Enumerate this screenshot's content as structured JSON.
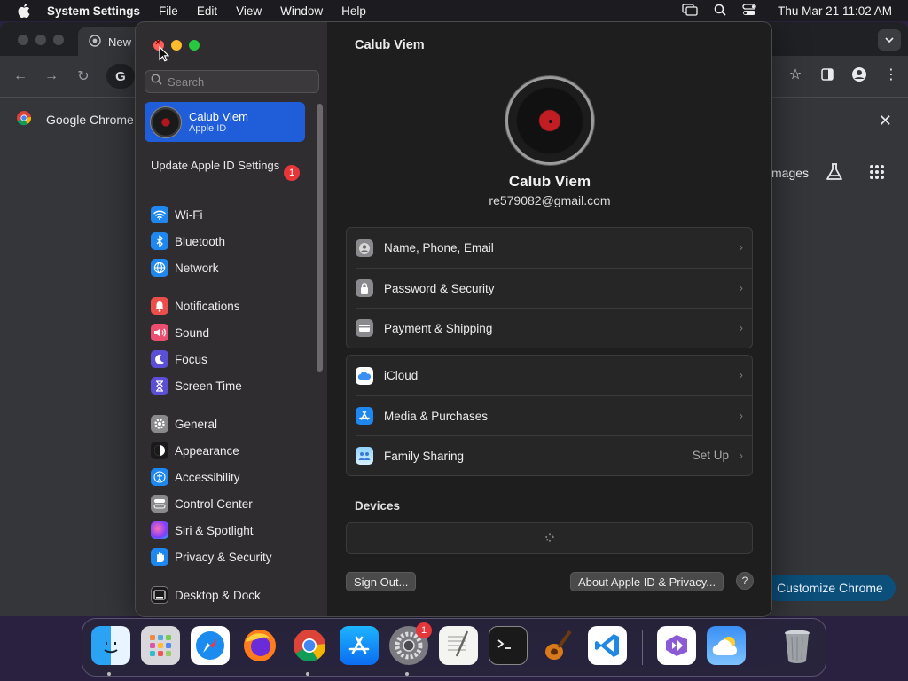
{
  "menubar": {
    "app_name": "System Settings",
    "menus": [
      "File",
      "Edit",
      "View",
      "Window",
      "Help"
    ],
    "clock": "Thu Mar 21  11:02 AM"
  },
  "chrome": {
    "tab_title": "New",
    "omnibox_letter": "G",
    "infobar_text": "Google Chrome i",
    "images_link": "mages",
    "customize_label": "Customize Chrome"
  },
  "settings": {
    "search_placeholder": "Search",
    "apple_id": {
      "name": "Calub Viem",
      "subtitle": "Apple ID"
    },
    "update_notice": "Update Apple ID Settings",
    "update_badge": "1",
    "sidebar_items": [
      {
        "label": "Wi-Fi",
        "icon": "wifi-icon",
        "color": "#1e88f0"
      },
      {
        "label": "Bluetooth",
        "icon": "bluetooth-icon",
        "color": "#1e88f0"
      },
      {
        "label": "Network",
        "icon": "globe-icon",
        "color": "#1e88f0"
      },
      {
        "label": "Notifications",
        "icon": "bell-icon",
        "color": "#eb4e4b"
      },
      {
        "label": "Sound",
        "icon": "speaker-icon",
        "color": "#eb4e6e"
      },
      {
        "label": "Focus",
        "icon": "moon-icon",
        "color": "#5b4fd6"
      },
      {
        "label": "Screen Time",
        "icon": "hourglass-icon",
        "color": "#5b4fd6"
      },
      {
        "label": "General",
        "icon": "gear-icon",
        "color": "#8a8a8e"
      },
      {
        "label": "Appearance",
        "icon": "appearance-icon",
        "color": "#1a1a1a"
      },
      {
        "label": "Accessibility",
        "icon": "accessibility-icon",
        "color": "#1e88f0"
      },
      {
        "label": "Control Center",
        "icon": "control-center-icon",
        "color": "#8a8a8e"
      },
      {
        "label": "Siri & Spotlight",
        "icon": "siri-icon",
        "color": "#b04fd6"
      },
      {
        "label": "Privacy & Security",
        "icon": "hand-icon",
        "color": "#1e88f0"
      },
      {
        "label": "Desktop & Dock",
        "icon": "dock-icon",
        "color": "#1a1a1a"
      }
    ],
    "main": {
      "title": "Calub Viem",
      "user_name": "Calub Viem",
      "user_email": "re579082@gmail.com",
      "group1": [
        {
          "label": "Name, Phone, Email",
          "icon": "contact-icon"
        },
        {
          "label": "Password & Security",
          "icon": "lock-icon"
        },
        {
          "label": "Payment & Shipping",
          "icon": "card-icon"
        }
      ],
      "group2": [
        {
          "label": "iCloud",
          "icon": "icloud-icon",
          "value": ""
        },
        {
          "label": "Media & Purchases",
          "icon": "app-store-icon",
          "value": ""
        },
        {
          "label": "Family Sharing",
          "icon": "family-icon",
          "value": "Set Up"
        }
      ],
      "devices_label": "Devices",
      "sign_out_label": "Sign Out...",
      "about_label": "About Apple ID & Privacy...",
      "help_label": "?"
    }
  },
  "dock": {
    "apps": [
      "Finder",
      "Launchpad",
      "Safari",
      "Firefox",
      "Google Chrome",
      "App Store",
      "System Settings",
      "TextEdit",
      "Terminal",
      "GarageBand",
      "Visual Studio Code",
      "Visual Studio",
      "Weather",
      "Trash"
    ],
    "settings_badge": "1"
  },
  "colors": {
    "accent": "#1f5ed8",
    "badge": "#e6363a",
    "traffic_red": "#fe5f57",
    "traffic_yellow": "#febc2e",
    "traffic_green": "#28c840"
  }
}
